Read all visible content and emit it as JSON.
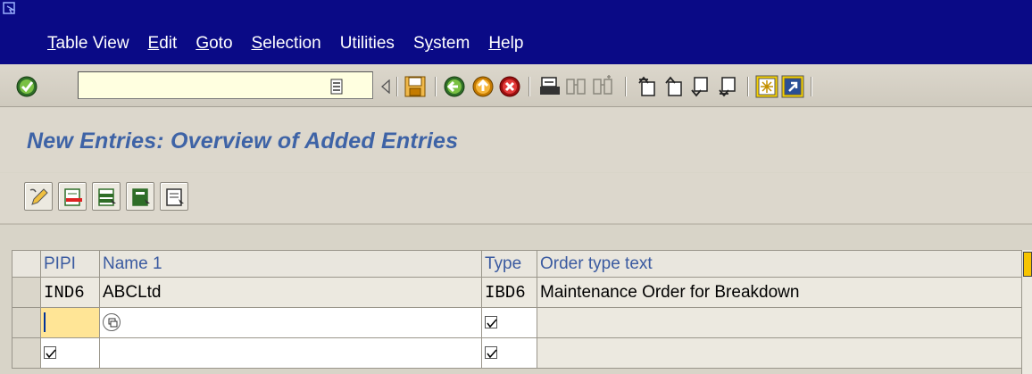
{
  "menu": {
    "items": [
      {
        "pre": "",
        "u": "T",
        "post": "able View"
      },
      {
        "pre": "",
        "u": "E",
        "post": "dit"
      },
      {
        "pre": "",
        "u": "G",
        "post": "oto"
      },
      {
        "pre": "",
        "u": "S",
        "post": "election"
      },
      {
        "pre": "Utilities",
        "u": "",
        "post": ""
      },
      {
        "pre": "S",
        "u": "y",
        "post": "stem"
      },
      {
        "pre": "",
        "u": "H",
        "post": "elp"
      }
    ]
  },
  "toolbar": {
    "command_field_value": "",
    "icons": [
      "enter-icon",
      "back-icon",
      "exit-icon",
      "cancel-icon",
      "print-icon",
      "find-icon",
      "find-next-icon",
      "first-page-icon",
      "previous-page-icon",
      "next-page-icon",
      "last-page-icon",
      "create-session-icon",
      "shortcut-icon"
    ]
  },
  "page": {
    "title": "New Entries: Overview of Added Entries"
  },
  "app_toolbar": {
    "icons": [
      "change-display-icon",
      "delete-icon",
      "select-all-icon",
      "select-block-icon",
      "deselect-all-icon"
    ]
  },
  "table": {
    "headers": [
      "PIPI",
      "Name 1",
      "Type",
      "Order type text"
    ],
    "rows": [
      {
        "pipi": "IND6",
        "name": "ABCLtd",
        "type": "IBD6",
        "text": "Maintenance Order for Breakdown"
      },
      {
        "pipi": "",
        "name": "",
        "type": "",
        "text": ""
      },
      {
        "pipi": "",
        "name": "",
        "type": "",
        "text": ""
      }
    ]
  },
  "colors": {
    "menubar": "#0a0a86",
    "title": "#3e63a6",
    "header_text": "#3a5aa0",
    "required_field": "#ffe596"
  }
}
